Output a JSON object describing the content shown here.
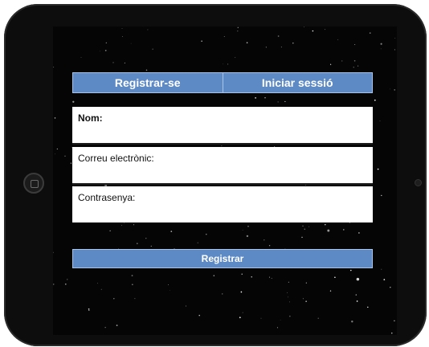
{
  "tabs": {
    "register": "Registrar-se",
    "login": "Iniciar sessió"
  },
  "form": {
    "name_label": "Nom:",
    "email_label": "Correu electrònic:",
    "password_label": "Contrasenya:",
    "submit_label": "Registrar"
  },
  "colors": {
    "accent": "#5d8ac4",
    "accent_border": "#a9c4e6",
    "background": "#050505",
    "device": "#0d0d0d"
  },
  "icons": {
    "home": "home-button-icon",
    "camera": "front-camera-icon"
  }
}
